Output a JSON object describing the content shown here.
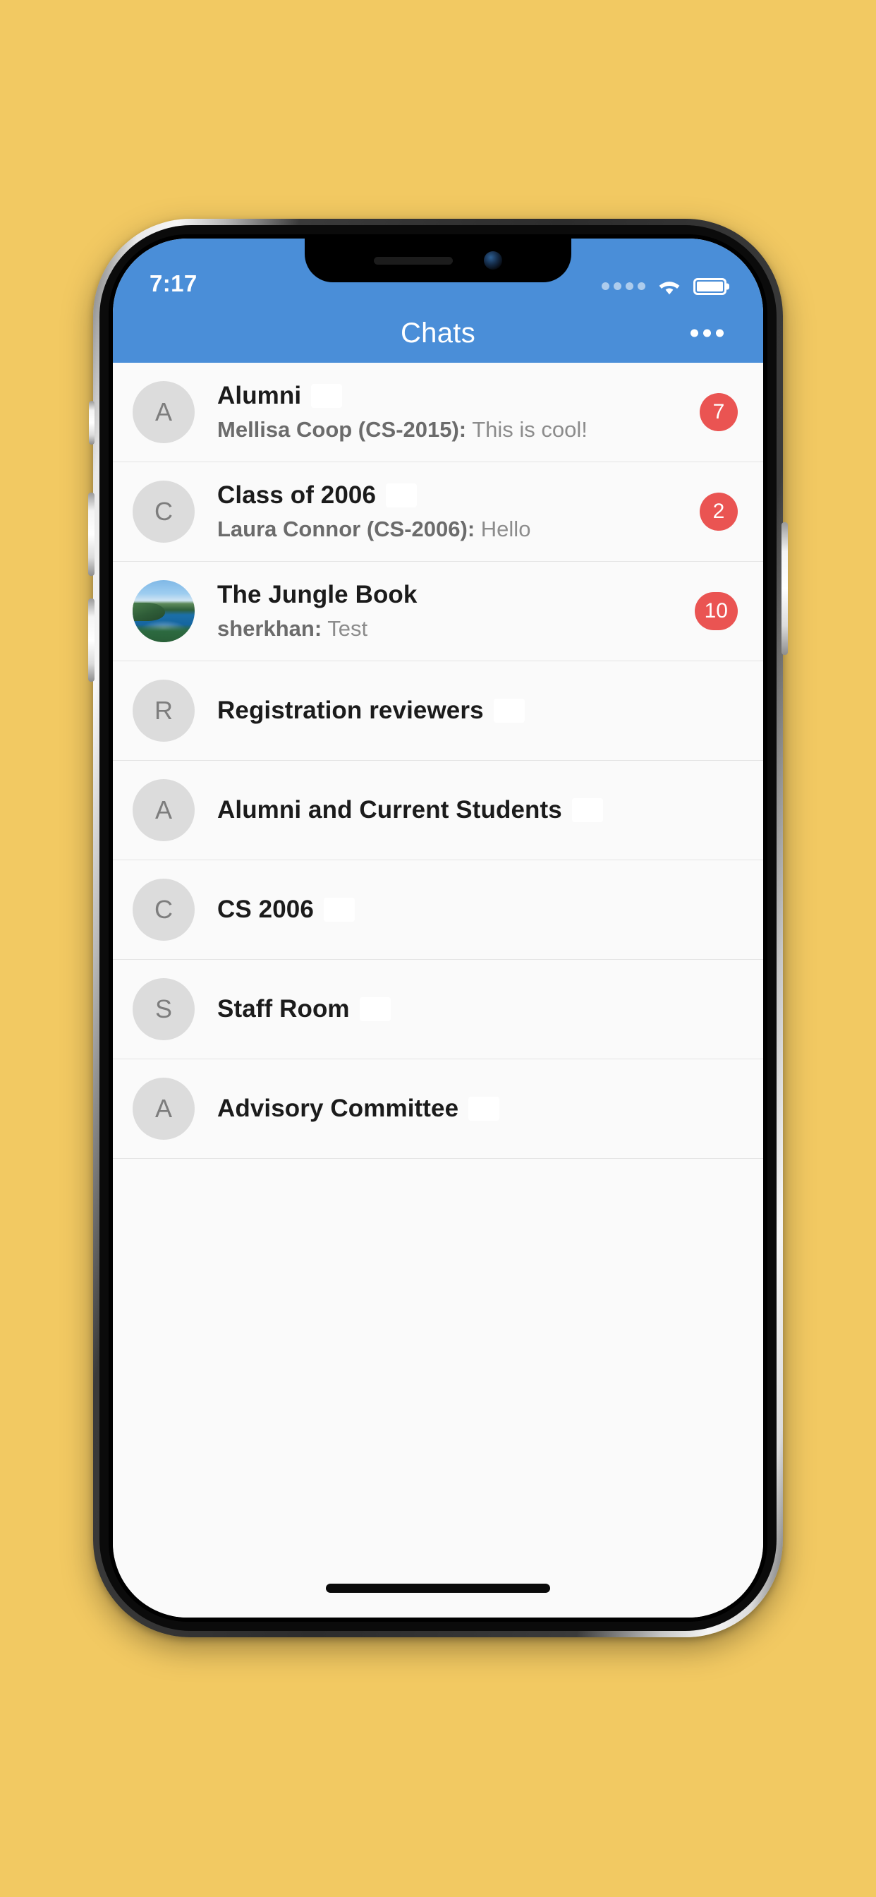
{
  "background_color": "#f2c962",
  "device": {
    "name": "iphone-x-mockup",
    "notch": {
      "speaker": "speaker-grill",
      "camera": "front-camera"
    },
    "buttons": [
      "silent-switch",
      "volume-up",
      "volume-down",
      "power"
    ]
  },
  "status_bar": {
    "time": "7:17",
    "background_color": "#4a8ed8",
    "signal": "signal-dots",
    "wifi": "wifi-icon",
    "battery": "battery-full-icon"
  },
  "nav_header": {
    "title": "Chats",
    "more_label": "•••",
    "background_color": "#4a8ed8"
  },
  "badge_color": "#ea5452",
  "chats": [
    {
      "avatar_type": "initial",
      "avatar_initial": "A",
      "title": "Alumni",
      "redacted": true,
      "preview_sender": "Mellisa Coop (CS-2015):",
      "preview_text": "This is cool!",
      "badge": "7"
    },
    {
      "avatar_type": "initial",
      "avatar_initial": "C",
      "title": "Class of 2006",
      "redacted": true,
      "preview_sender": "Laura Connor (CS-2006):",
      "preview_text": "Hello",
      "badge": "2"
    },
    {
      "avatar_type": "photo",
      "avatar_initial": "",
      "title": "The Jungle Book",
      "redacted": false,
      "preview_sender": "sherkhan:",
      "preview_text": "Test",
      "badge": "10"
    },
    {
      "avatar_type": "initial",
      "avatar_initial": "R",
      "title": "Registration reviewers",
      "redacted": true,
      "preview_sender": "",
      "preview_text": "",
      "badge": ""
    },
    {
      "avatar_type": "initial",
      "avatar_initial": "A",
      "title": "Alumni and Current Students",
      "redacted": true,
      "preview_sender": "",
      "preview_text": "",
      "badge": ""
    },
    {
      "avatar_type": "initial",
      "avatar_initial": "C",
      "title": "CS 2006",
      "redacted": true,
      "preview_sender": "",
      "preview_text": "",
      "badge": ""
    },
    {
      "avatar_type": "initial",
      "avatar_initial": "S",
      "title": "Staff Room",
      "redacted": true,
      "preview_sender": "",
      "preview_text": "",
      "badge": ""
    },
    {
      "avatar_type": "initial",
      "avatar_initial": "A",
      "title": "Advisory Committee",
      "redacted": true,
      "preview_sender": "",
      "preview_text": "",
      "badge": ""
    }
  ],
  "home_indicator": "home-indicator"
}
